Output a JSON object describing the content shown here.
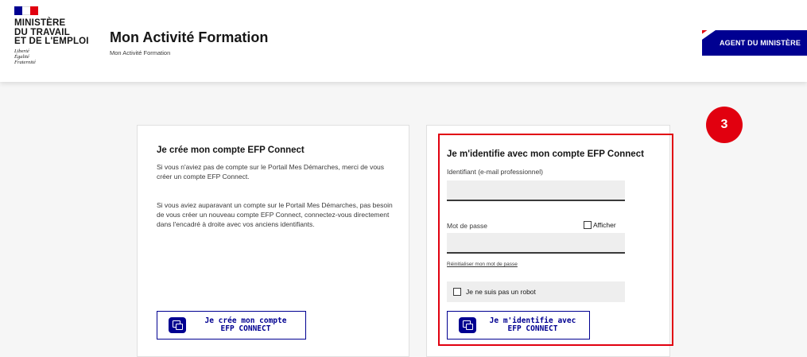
{
  "header": {
    "flag_colors": [
      "#000091",
      "#ffffff",
      "#e1000f"
    ],
    "ministry_lines": [
      "MINISTÈRE",
      "DU TRAVAIL",
      "ET DE L'EMPLOI"
    ],
    "motto_lines": [
      "Liberté",
      "Égalité",
      "Fraternité"
    ],
    "site_title": "Mon Activité Formation",
    "site_subtitle": "Mon Activité Formation",
    "agent_button": "AGENT DU MINISTÈRE"
  },
  "create_card": {
    "title": "Je crée mon compte EFP Connect",
    "paragraph1": "Si vous n'aviez pas de compte sur le Portail Mes Démarches, merci de vous créer un compte EFP Connect.",
    "paragraph2": "Si vous aviez auparavant un compte sur le Portail Mes Démarches, pas besoin de vous créer un nouveau compte EFP Connect, connectez-vous directement dans l'encadré à droite avec vos anciens identifiants.",
    "button_line1": "Je crée mon compte",
    "button_line2": "EFP CONNECT"
  },
  "login_card": {
    "title": "Je m'identifie avec mon compte EFP Connect",
    "identifier_label": "Identifiant (e-mail professionnel)",
    "identifier_value": "",
    "password_label": "Mot de passe",
    "password_value": "",
    "show_password_label": "Afficher",
    "reset_link": "Réinitialiser mon mot de passe",
    "captcha_label": "Je ne suis pas un robot",
    "button_line1": "Je m'identifie avec",
    "button_line2": "EFP CONNECT"
  },
  "annotation": {
    "step_number": "3",
    "color": "#e1000f"
  },
  "colors": {
    "accent": "#000091",
    "highlight": "#e1000f"
  }
}
